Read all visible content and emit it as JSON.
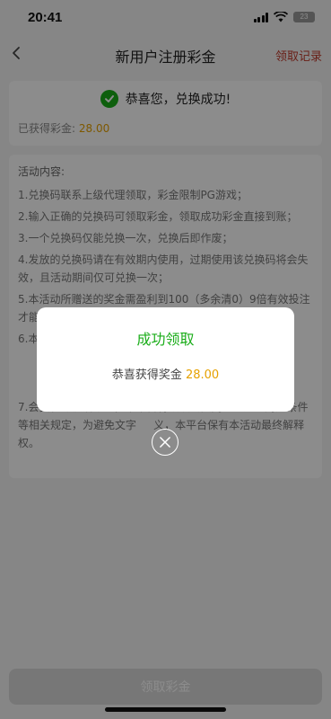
{
  "status_bar": {
    "time": "20:41",
    "battery": "23"
  },
  "nav": {
    "title": "新用户注册彩金",
    "record_link": "领取记录"
  },
  "success": {
    "message": "恭喜您，兑换成功!",
    "obtained_label": "已获得彩金:",
    "obtained_amount": "28.00"
  },
  "rules": {
    "title": "活动内容:",
    "items": [
      "1.兑换码联系上级代理领取，彩金限制PG游戏；",
      "2.输入正确的兑换码可领取彩金，领取成功彩金直接到账；",
      "3.一个兑换码仅能兑换一次，兑换后即作废；",
      "4.发放的兑换码请在有效期内使用，过期使用该兑换码将会失效，且活动期间仅可兑换一次；",
      "5.本活动所赠送的奖金需盈利到100（多余清0）9倍有效投注才能",
      "6.本",
      "7.会员参与该活动时，本平台将默认会员同意且遵守对应条件等相关规定，为避免文字",
      "义，本平台保有本活动最终解释权。"
    ]
  },
  "modal": {
    "title": "成功领取",
    "message_prefix": "恭喜获得奖金",
    "amount": "28.00"
  },
  "bottom_button": {
    "label": "领取彩金"
  },
  "colors": {
    "success_green": "#1aad19",
    "amount_gold": "#e6a100",
    "link_red": "#c0392b"
  }
}
